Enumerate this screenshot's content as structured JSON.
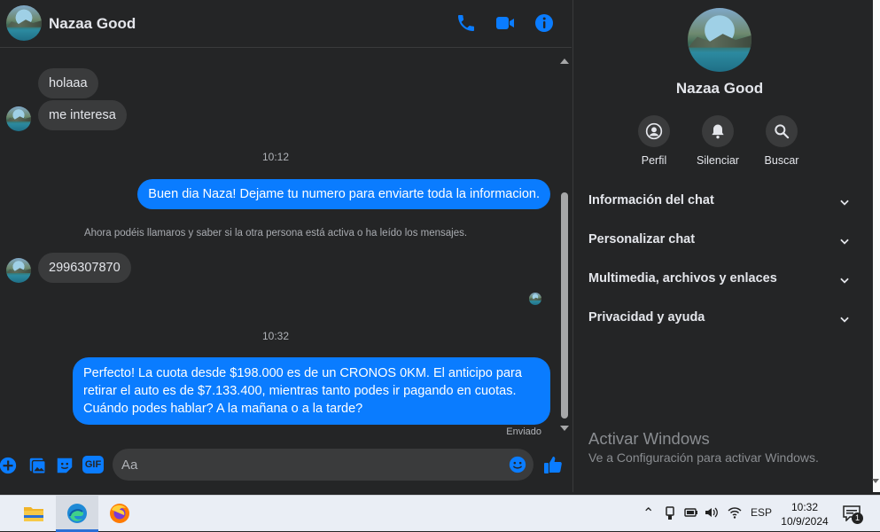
{
  "header": {
    "contact_name": "Nazaa Good",
    "icons": [
      "phone-icon",
      "video-camera-icon",
      "info-icon"
    ]
  },
  "messages": {
    "in1": "holaaa",
    "in2": "me interesa",
    "time1": "10:12",
    "out1": "Buen dia Naza! Dejame tu numero para enviarte toda la informacion.",
    "system": "Ahora podéis llamaros y saber si la otra persona está activa o ha leído los mensajes.",
    "in3": "2996307870",
    "time2": "10:32",
    "out2": "Perfecto! La cuota desde $198.000 es de un CRONOS 0KM. El anticipo para retirar el auto es de $7.133.400, mientras tanto podes ir pagando en cuotas. Cuándo podes hablar? A la mañana o a la tarde?",
    "status": "Enviado"
  },
  "composer": {
    "placeholder": "Aa",
    "icons": [
      "plus-icon",
      "image-icon",
      "sticker-icon",
      "gif-icon",
      "emoji-icon",
      "like-icon"
    ],
    "gif_label": "GIF"
  },
  "sidebar": {
    "contact_name": "Nazaa Good",
    "actions": [
      {
        "label": "Perfil",
        "icon": "profile-icon"
      },
      {
        "label": "Silenciar",
        "icon": "bell-icon"
      },
      {
        "label": "Buscar",
        "icon": "search-icon"
      }
    ],
    "sections": [
      {
        "label": "Información del chat"
      },
      {
        "label": "Personalizar chat"
      },
      {
        "label": "Multimedia, archivos y enlaces"
      },
      {
        "label": "Privacidad y ayuda"
      }
    ],
    "watermark_title": "Activar Windows",
    "watermark_sub": "Ve a Configuración para activar Windows."
  },
  "taskbar": {
    "apps": [
      "file-explorer-icon",
      "edge-icon",
      "firefox-icon"
    ],
    "language": "ESP",
    "time": "10:32",
    "date": "10/9/2024",
    "notification_count": "1"
  },
  "colors": {
    "background": "#242526",
    "bubble_in": "#3a3b3c",
    "bubble_out": "#0a7cff",
    "accent": "#0a7cff"
  }
}
